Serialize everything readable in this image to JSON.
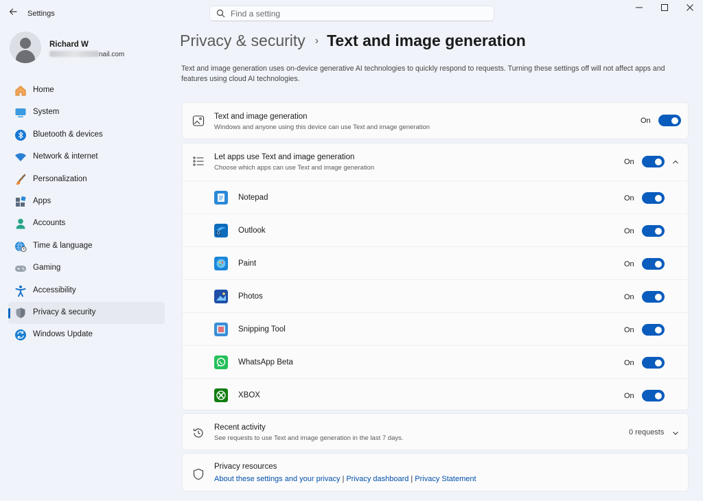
{
  "window": {
    "title": "Settings",
    "controls": {
      "minimize": "—",
      "maximize": "☐",
      "close": "✕"
    }
  },
  "search": {
    "placeholder": "Find a setting"
  },
  "profile": {
    "name": "Richard W",
    "email_suffix": "nail.com"
  },
  "sidebar": {
    "items": [
      {
        "label": "Home",
        "icon": "home-icon"
      },
      {
        "label": "System",
        "icon": "system-icon"
      },
      {
        "label": "Bluetooth & devices",
        "icon": "bluetooth-icon"
      },
      {
        "label": "Network & internet",
        "icon": "wifi-icon"
      },
      {
        "label": "Personalization",
        "icon": "brush-icon"
      },
      {
        "label": "Apps",
        "icon": "apps-icon"
      },
      {
        "label": "Accounts",
        "icon": "accounts-icon"
      },
      {
        "label": "Time & language",
        "icon": "globe-clock-icon"
      },
      {
        "label": "Gaming",
        "icon": "gamepad-icon"
      },
      {
        "label": "Accessibility",
        "icon": "accessibility-icon"
      },
      {
        "label": "Privacy & security",
        "icon": "shield-icon",
        "active": true
      },
      {
        "label": "Windows Update",
        "icon": "update-icon"
      }
    ]
  },
  "breadcrumb": {
    "parent": "Privacy & security",
    "separator": "›",
    "current": "Text and image generation"
  },
  "description": "Text and image generation uses on-device generative AI technologies to quickly respond to requests. Turning these settings off will not affect apps and features using cloud AI technologies.",
  "main_toggle": {
    "title": "Text and image generation",
    "subtitle": "Windows and anyone using this device can use Text and image generation",
    "state": "On",
    "checked": true
  },
  "apps_section": {
    "title": "Let apps use Text and image generation",
    "subtitle": "Choose which apps can use Text and image generation",
    "state": "On",
    "checked": true,
    "expanded": true,
    "apps": [
      {
        "name": "Notepad",
        "state": "On",
        "color": "#2b88d8",
        "icon": "notepad-icon"
      },
      {
        "name": "Outlook",
        "state": "On",
        "color": "#0f6cbd",
        "icon": "outlook-icon"
      },
      {
        "name": "Paint",
        "state": "On",
        "color": "#1a86d9",
        "icon": "paint-icon"
      },
      {
        "name": "Photos",
        "state": "On",
        "color": "#1e4fa8",
        "icon": "photos-icon"
      },
      {
        "name": "Snipping Tool",
        "state": "On",
        "color": "#3b8fd6",
        "icon": "snipping-tool-icon"
      },
      {
        "name": "WhatsApp Beta",
        "state": "On",
        "color": "#25c05a",
        "icon": "whatsapp-icon"
      },
      {
        "name": "XBOX",
        "state": "On",
        "color": "#107c10",
        "icon": "xbox-icon"
      }
    ]
  },
  "recent_activity": {
    "title": "Recent activity",
    "subtitle": "See requests to use Text and image generation in the last 7 days.",
    "value": "0 requests"
  },
  "privacy_resources": {
    "title": "Privacy resources",
    "links": [
      "About these settings and your privacy",
      "Privacy dashboard",
      "Privacy Statement"
    ],
    "separator": "|"
  },
  "colors": {
    "accent": "#0a5cbd",
    "background": "#f0f3f9",
    "card": "#fbfbfc"
  }
}
